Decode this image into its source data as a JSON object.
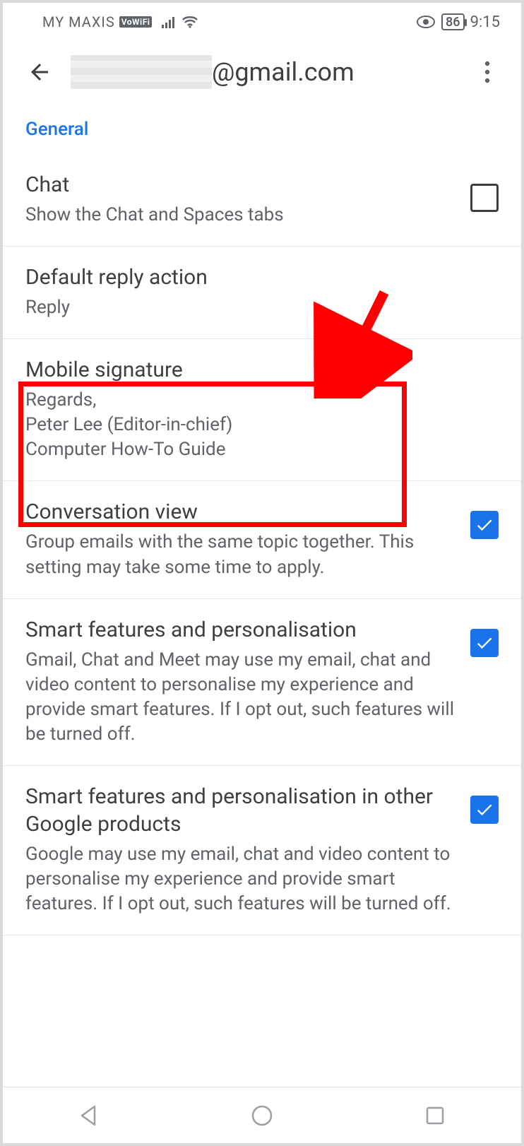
{
  "statusbar": {
    "carrier": "MY MAXIS",
    "vowifi_badge": "VoWiFi",
    "battery": "86",
    "time": "9:15"
  },
  "header": {
    "email_suffix": "@gmail.com"
  },
  "section_label": "General",
  "settings": {
    "chat": {
      "title": "Chat",
      "sub": "Show the Chat and Spaces tabs",
      "checked": false
    },
    "reply": {
      "title": "Default reply action",
      "sub": "Reply"
    },
    "signature": {
      "title": "Mobile signature",
      "sub": "Regards,\nPeter Lee (Editor-in-chief)\nComputer How-To Guide"
    },
    "conversation": {
      "title": "Conversation view",
      "sub": "Group emails with the same topic together. This setting may take some time to apply.",
      "checked": true
    },
    "smart1": {
      "title": "Smart features and personalisation",
      "sub": "Gmail, Chat and Meet may use my email, chat and video content to personalise my experience and provide smart features. If I opt out, such features will be turned off.",
      "checked": true
    },
    "smart2": {
      "title": "Smart features and personalisation in other Google products",
      "sub": "Google may use my email, chat and video content to personalise my experience and provide smart features. If I opt out, such features will be turned off.",
      "checked": true
    }
  }
}
